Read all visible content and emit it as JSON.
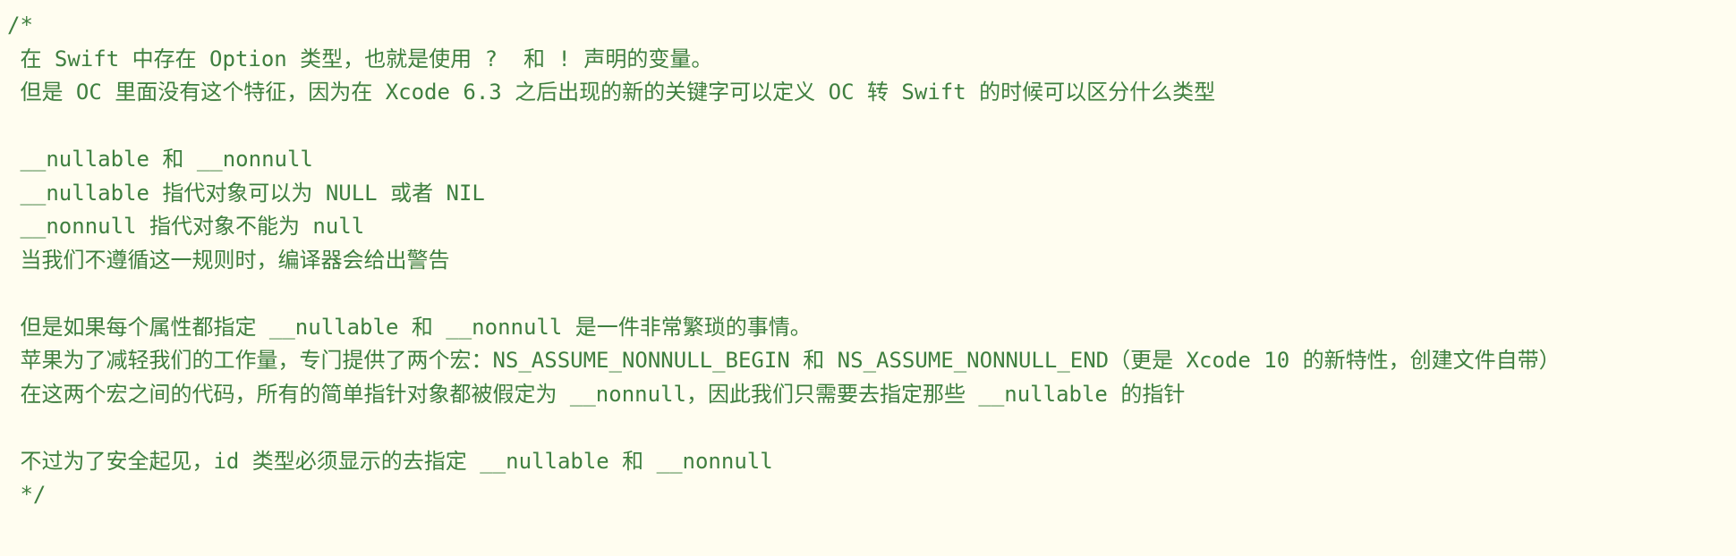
{
  "editor": {
    "comment_color": "#3f7f3f",
    "background_color": "#fffdf0",
    "lines": [
      "/*",
      " 在 Swift 中存在 Option 类型，也就是使用 ?  和 ! 声明的变量。",
      " 但是 OC 里面没有这个特征，因为在 Xcode 6.3 之后出现的新的关键字可以定义 OC 转 Swift 的时候可以区分什么类型",
      "",
      " __nullable 和 __nonnull",
      " __nullable 指代对象可以为 NULL 或者 NIL",
      " __nonnull 指代对象不能为 null",
      " 当我们不遵循这一规则时，编译器会给出警告",
      "",
      " 但是如果每个属性都指定 __nullable 和 __nonnull 是一件非常繁琐的事情。",
      " 苹果为了减轻我们的工作量，专门提供了两个宏：NS_ASSUME_NONNULL_BEGIN 和 NS_ASSUME_NONNULL_END（更是 Xcode 10 的新特性，创建文件自带）",
      " 在这两个宏之间的代码，所有的简单指针对象都被假定为 __nonnull，因此我们只需要去指定那些 __nullable 的指针",
      "",
      " 不过为了安全起见，id 类型必须显示的去指定 __nullable 和 __nonnull",
      " */"
    ]
  }
}
